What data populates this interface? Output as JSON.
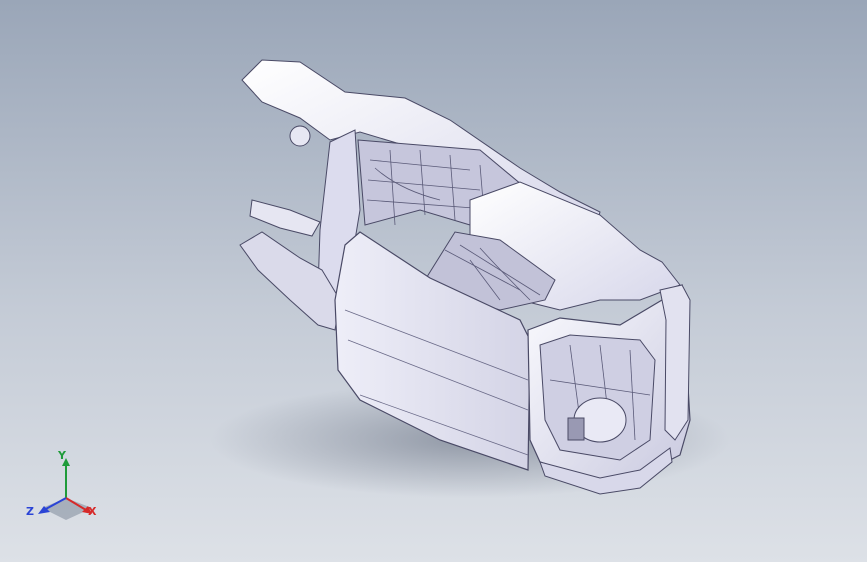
{
  "triad": {
    "x_label": "X",
    "y_label": "Y",
    "z_label": "Z",
    "x_color": "#d62a2a",
    "y_color": "#1f9b3a",
    "z_color": "#2a44d6"
  },
  "viewport": {
    "background_top": "#9aa6b8",
    "background_bottom": "#dde1e7"
  }
}
